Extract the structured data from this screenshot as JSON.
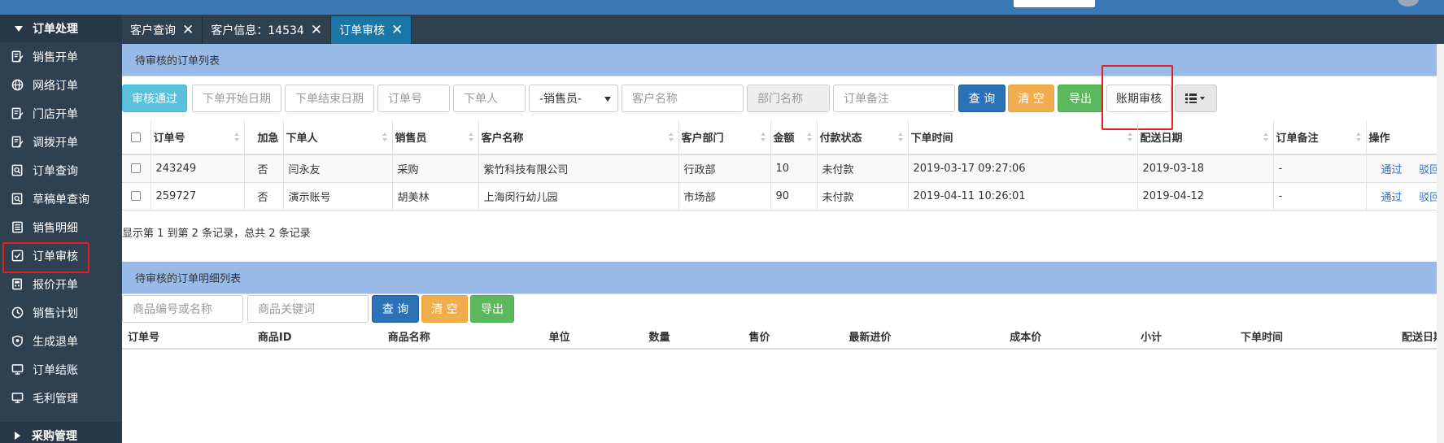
{
  "sidebar": {
    "group_top": "订单处理",
    "items": [
      {
        "label": "销售开单",
        "icon": "edit-doc-icon"
      },
      {
        "label": "网络订单",
        "icon": "globe-icon"
      },
      {
        "label": "门店开单",
        "icon": "edit-doc-icon"
      },
      {
        "label": "调拨开单",
        "icon": "edit-doc-icon"
      },
      {
        "label": "订单查询",
        "icon": "search-doc-icon"
      },
      {
        "label": "草稿单查询",
        "icon": "search-doc-icon"
      },
      {
        "label": "销售明细",
        "icon": "list-doc-icon"
      },
      {
        "label": "订单审核",
        "icon": "checkbox-icon"
      },
      {
        "label": "报价开单",
        "icon": "calculator-icon"
      },
      {
        "label": "销售计划",
        "icon": "clock-icon"
      },
      {
        "label": "生成退单",
        "icon": "shield-icon"
      },
      {
        "label": "订单结账",
        "icon": "monitor-icon"
      },
      {
        "label": "毛利管理",
        "icon": "monitor-icon"
      }
    ],
    "group_bottom": "采购管理"
  },
  "tabs": [
    {
      "label": "客户查询",
      "active": false
    },
    {
      "label": "客户信息：14534",
      "active": false
    },
    {
      "label": "订单审核",
      "active": true
    }
  ],
  "orders_panel": {
    "title": "待审核的订单列表",
    "buttons": {
      "approve": "审核通过",
      "query": "查 询",
      "clear": "清 空",
      "export": "导出",
      "period_audit": "账期审核"
    },
    "placeholders": {
      "start_date": "下单开始日期",
      "end_date": "下单结束日期",
      "order_no": "订单号",
      "orderer": "下单人",
      "salesman": "-销售员-",
      "customer": "客户名称",
      "department": "部门名称",
      "remark": "订单备注"
    },
    "columns": [
      "订单号",
      "加急",
      "下单人",
      "销售员",
      "客户名称",
      "客户部门",
      "金额",
      "付款状态",
      "下单时间",
      "配送日期",
      "订单备注",
      "操作"
    ],
    "rows": [
      {
        "order_no": "243249",
        "urgent": "否",
        "orderer": "闫永友",
        "salesman": "采购",
        "customer": "紫竹科技有限公司",
        "dept": "行政部",
        "amount": "10",
        "pay_status": "未付款",
        "order_time": "2019-03-17 09:27:06",
        "delivery": "2019-03-18",
        "remark": "-",
        "action_pass": "通过",
        "action_reject": "驳回"
      },
      {
        "order_no": "259727",
        "urgent": "否",
        "orderer": "演示账号",
        "salesman": "胡美林",
        "customer": "上海闵行幼儿园",
        "dept": "市场部",
        "amount": "90",
        "pay_status": "未付款",
        "order_time": "2019-04-11 10:26:01",
        "delivery": "2019-04-12",
        "remark": "-",
        "action_pass": "通过",
        "action_reject": "驳回"
      }
    ],
    "summary": "显示第 1 到第 2 条记录，总共 2 条记录"
  },
  "detail_panel": {
    "title": "待审核的订单明细列表",
    "placeholders": {
      "product_code": "商品编号或名称",
      "keyword": "商品关键词"
    },
    "buttons": {
      "query": "查 询",
      "clear": "清 空",
      "export": "导出"
    },
    "columns": [
      "订单号",
      "商品ID",
      "商品名称",
      "单位",
      "数量",
      "售价",
      "最新进价",
      "成本价",
      "小计",
      "下单时间",
      "配送日期"
    ]
  },
  "colors": {
    "sidebar_bg": "#2f4050",
    "topbar": "#3a78b6",
    "panel_head": "#99b9e6",
    "highlight_red": "#e0201f"
  }
}
